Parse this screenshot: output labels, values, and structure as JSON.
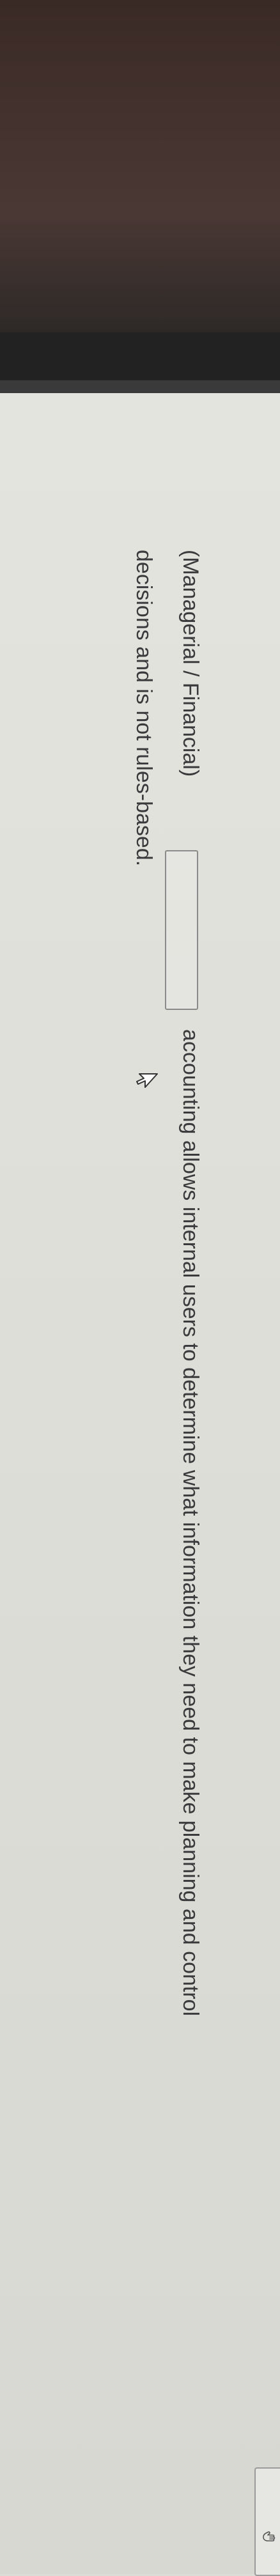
{
  "question": {
    "prefix": "(Managerial / Financial)",
    "answer_value": "",
    "line1_suffix": "accounting allows internal users to determine what information they need to make planning and control",
    "line2": "decisions and is not rules-based."
  },
  "icons": {
    "cursor": "mouse-pointer-icon",
    "corner": "hand-icon"
  },
  "colors": {
    "text": "#3a3a3c",
    "box_border": "#8a8a8a",
    "screen_bg": "#dcdcd6"
  }
}
